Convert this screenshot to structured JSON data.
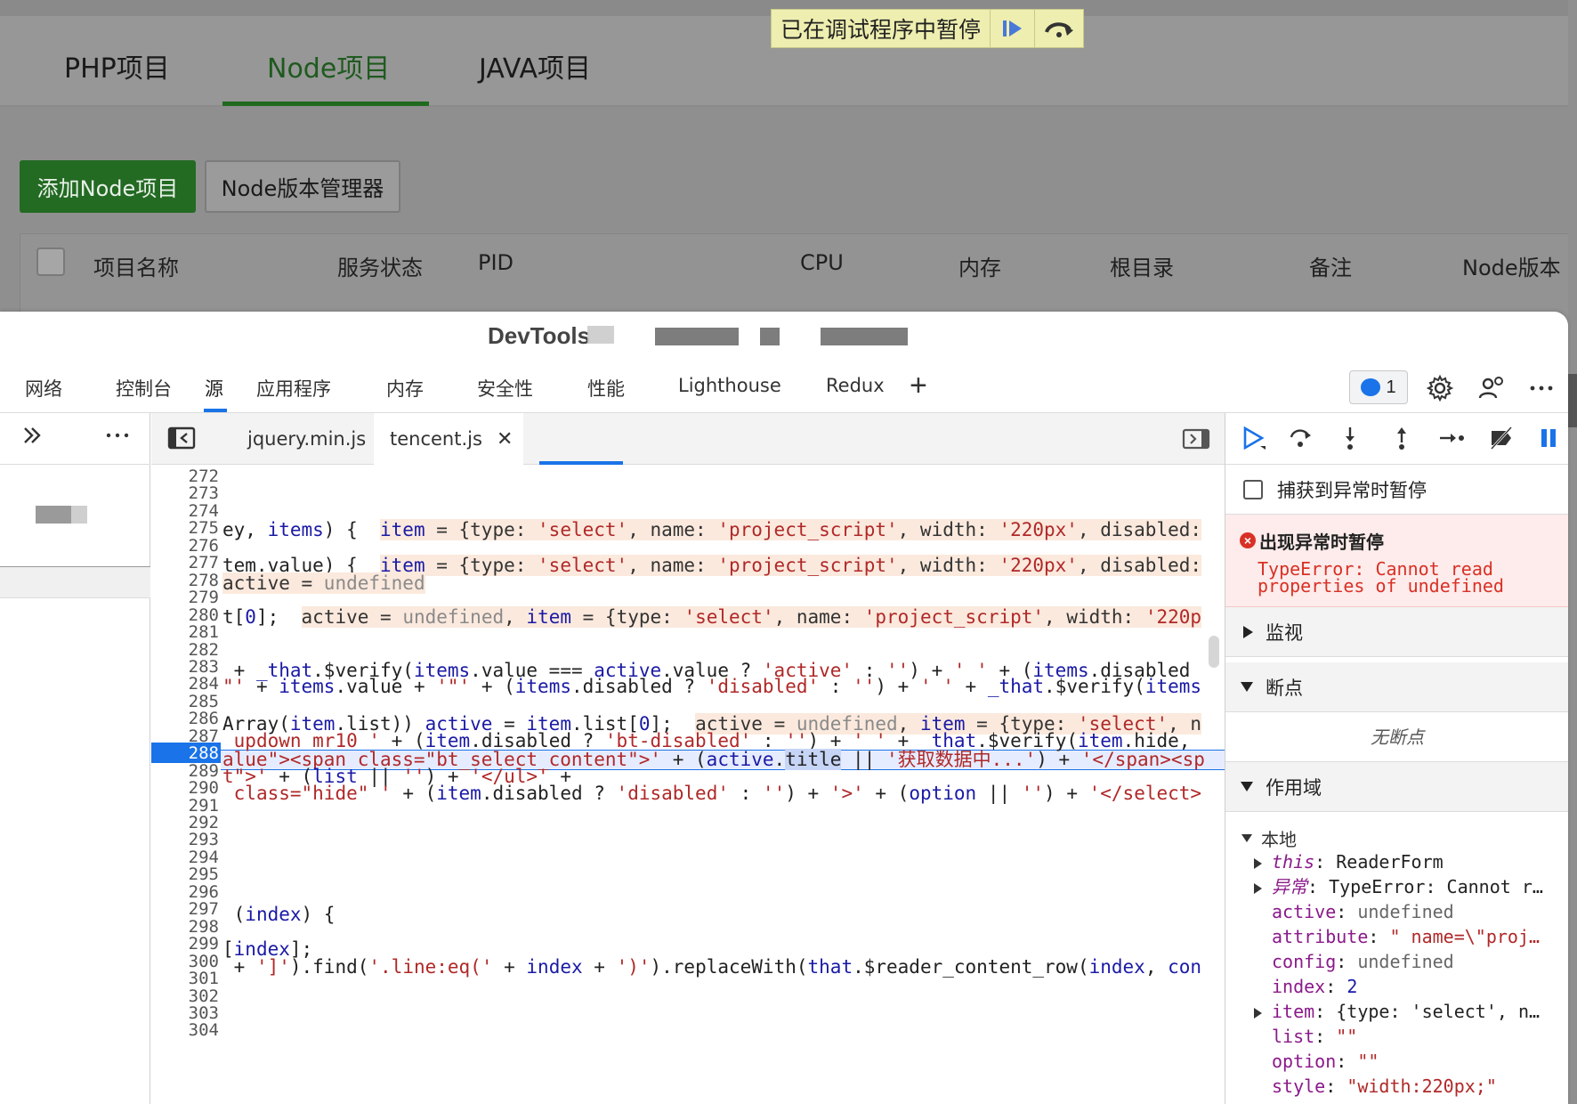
{
  "page": {
    "tabs": [
      "PHP项目",
      "Node项目",
      "JAVA项目"
    ],
    "active_tab": "Node项目",
    "pause_banner": "已在调试程序中暂停",
    "buttons": {
      "add": "添加Node项目",
      "version_manager": "Node版本管理器"
    },
    "table_headers": [
      "项目名称",
      "服务状态",
      "PID",
      "CPU",
      "内存",
      "根目录",
      "备注",
      "Node版本"
    ]
  },
  "devtools": {
    "title": "DevTools",
    "tabs": [
      "网络",
      "控制台",
      "源",
      "应用程序",
      "内存",
      "安全性",
      "性能",
      "Lighthouse",
      "Redux"
    ],
    "active_tab": "源",
    "issues_count": "1",
    "file_tabs": [
      "jquery.min.js",
      "tencent.js"
    ],
    "active_file": "tencent.js",
    "debugger": {
      "pause_on_caught": "捕获到异常时暂停",
      "paused_title": "出现异常时暂停",
      "paused_message": "TypeError: Cannot read properties of undefined",
      "watch": "监视",
      "breakpoints": "断点",
      "no_breakpoints": "无断点",
      "scope": "作用域",
      "local": "本地"
    }
  },
  "editor": {
    "current_line": 288,
    "line_numbers": [
      272,
      273,
      274,
      275,
      276,
      277,
      278,
      279,
      280,
      281,
      282,
      283,
      284,
      285,
      286,
      287,
      288,
      289,
      290,
      291,
      292,
      293,
      294,
      295,
      296,
      297,
      298,
      299,
      300,
      301,
      302,
      303,
      304
    ]
  },
  "scope_vars": [
    {
      "key": "this",
      "value": "ReaderForm"
    },
    {
      "key": "异常",
      "value": "TypeError: Cannot r…"
    },
    {
      "key": "active",
      "value": "undefined"
    },
    {
      "key": "attribute",
      "value": "\" name=\\\"proj…"
    },
    {
      "key": "config",
      "value": "undefined"
    },
    {
      "key": "index",
      "value": "2"
    },
    {
      "key": "item",
      "value": "{type: 'select', n…"
    },
    {
      "key": "list",
      "value": "\"\""
    },
    {
      "key": "option",
      "value": "\"\""
    },
    {
      "key": "style",
      "value": "\"width:220px;\""
    }
  ],
  "colors": {
    "accent": "#1a73e8",
    "error": "#d93025",
    "page_green": "#236a23"
  }
}
